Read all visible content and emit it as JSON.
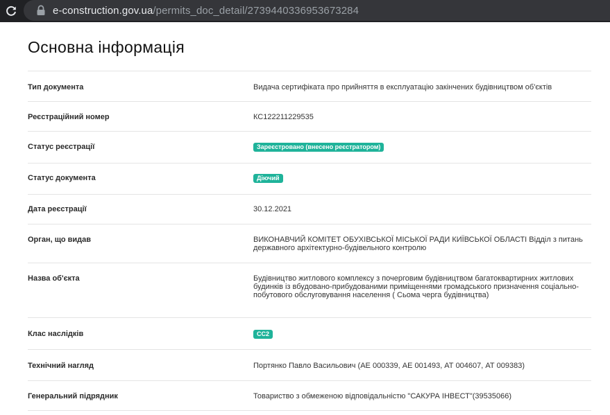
{
  "browser": {
    "url_domain": "e-construction.gov.ua",
    "url_path": "/permits_doc_detail/2739440336953673284"
  },
  "page": {
    "title": "Основна інформація"
  },
  "rows": [
    {
      "label": "Тип документа",
      "value": "Видача сертифіката про прийняття в експлуатацію закінчених будівництвом об'єктів"
    },
    {
      "label": "Реєстраційний номер",
      "value": "КС122211229535"
    },
    {
      "label": "Статус реєстрації",
      "badge": "Зареєстровано (внесено реєстратором)"
    },
    {
      "label": "Статус документа",
      "badge": "Діючий"
    },
    {
      "label": "Дата реєстрації",
      "value": "30.12.2021"
    },
    {
      "label": "Орган, що видав",
      "value": "ВИКОНАВЧИЙ КОМІТЕТ ОБУХІВСЬКОЇ МІСЬКОЇ РАДИ КИЇВСЬКОЇ ОБЛАСТІ Відділ з питань державного архітектурно-будівельного контролю"
    },
    {
      "label": "Назва об'єкта",
      "value": "Будівництво житлового комплексу з почерговим будівництвом багатоквартирних житлових будинків із вбудовано-прибудованими приміщеннями громадського призначення соціально-побутового обслуговування населення ( Сьома черга будівництва)"
    },
    {
      "label": "Клас наслідків",
      "badge": "СС2"
    },
    {
      "label": "Технічний нагляд",
      "value": "Портянко Павло Васильович (АЕ 000339, АЕ 001493, АТ 004607, АТ 009383)"
    },
    {
      "label": "Генеральний підрядник",
      "value": "Товариство з обмеженою відповідальністю \"САКУРА ІНВЕСТ\"(39535066)"
    }
  ],
  "colors": {
    "badge": "#1fb39a",
    "browser_bar": "#202124",
    "url_box": "#35363a"
  },
  "icons": [
    "reload-icon",
    "lock-icon"
  ]
}
